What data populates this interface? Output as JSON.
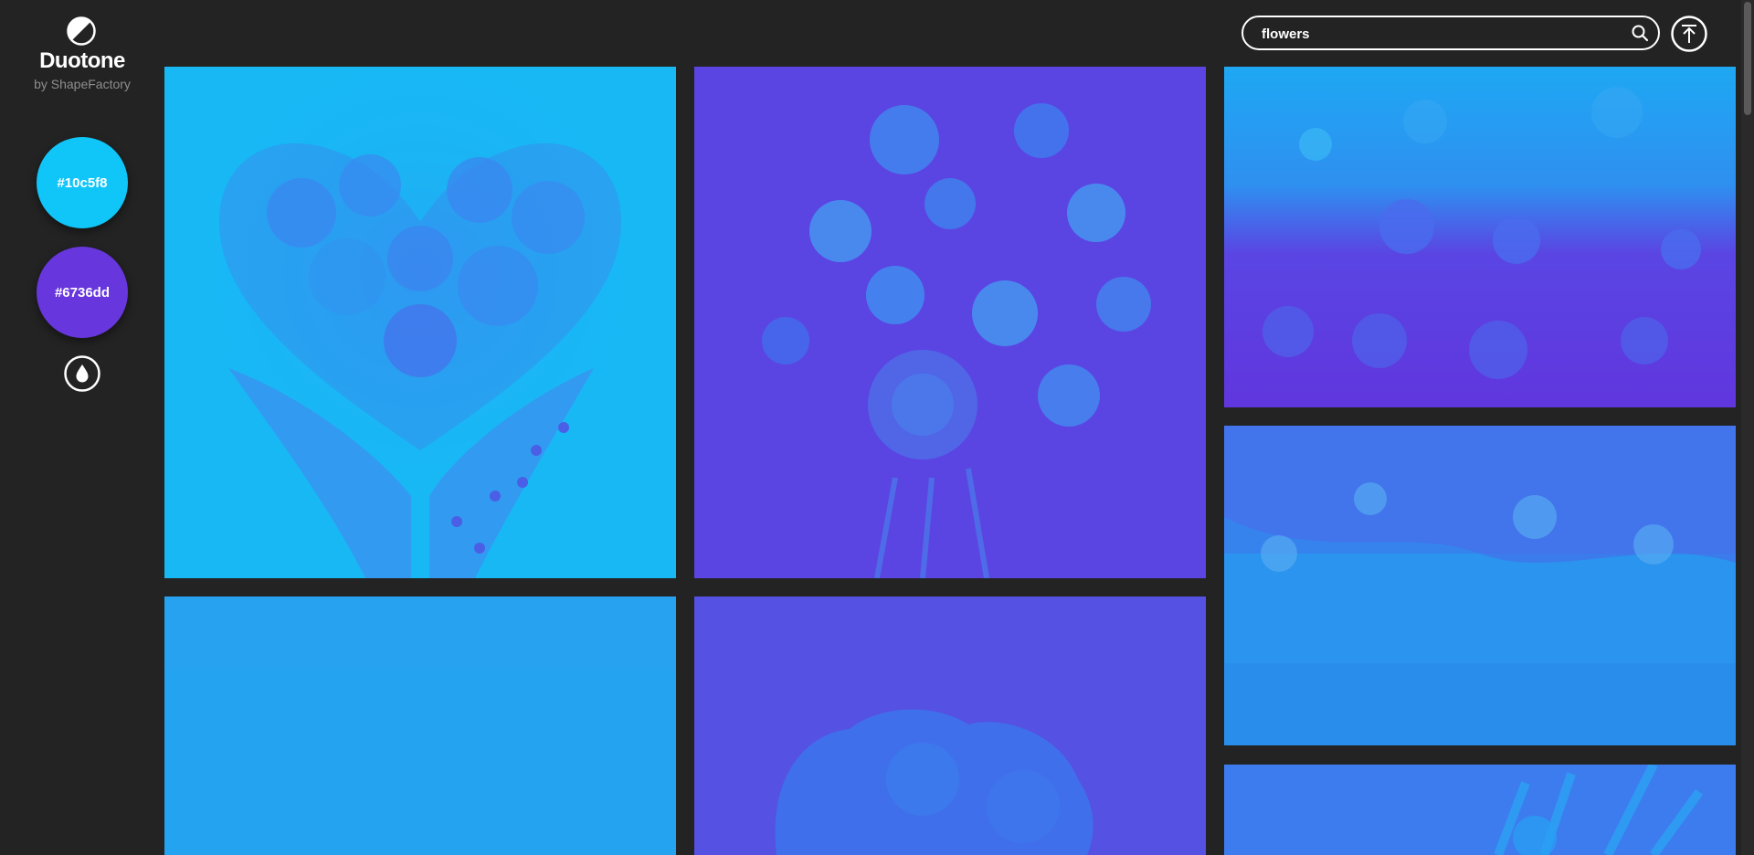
{
  "app": {
    "title": "Duotone",
    "subtitle": "by ShapeFactory",
    "logo_icon": "half-circle-icon"
  },
  "colors": {
    "background": "#232323",
    "primary": "#10c5f8",
    "secondary": "#6736dd"
  },
  "sidebar": {
    "swatches": [
      {
        "label": "#10c5f8",
        "color": "#10c5f8"
      },
      {
        "label": "#6736dd",
        "color": "#6736dd"
      }
    ],
    "drop_icon": "water-drop-icon"
  },
  "search": {
    "value": "flowers",
    "icon": "search-icon"
  },
  "top_button": {
    "icon": "scroll-to-top-icon"
  },
  "gallery": {
    "query": "flowers",
    "images": [
      {
        "subject": "heart-shaped flower bouquet held in hands"
      },
      {
        "subject": "large rose bouquet"
      },
      {
        "subject": "dahlia field with bokeh background"
      },
      {
        "subject": "floral wedding arch"
      },
      {
        "subject": "flower stems close-up"
      },
      {
        "subject": "blurred background"
      },
      {
        "subject": "carnation close-up"
      }
    ]
  }
}
